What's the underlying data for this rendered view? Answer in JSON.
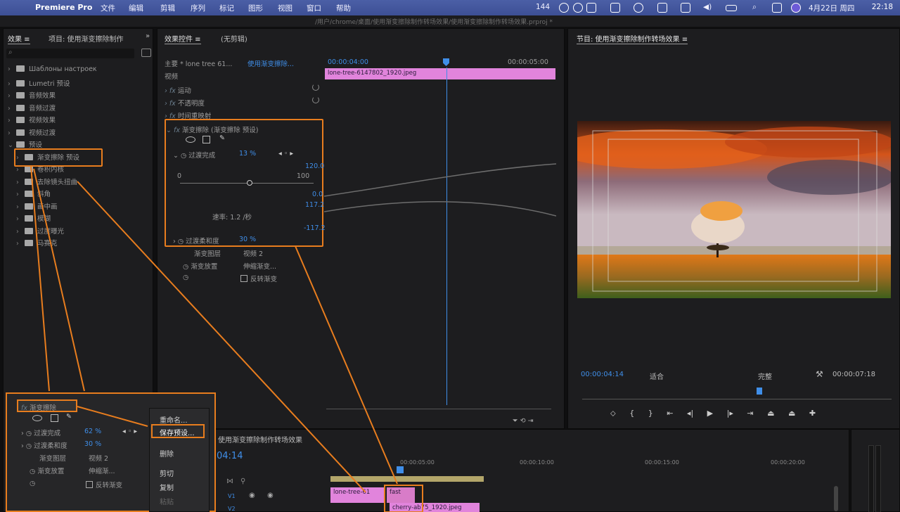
{
  "menubar": {
    "app": "Premiere Pro",
    "items": [
      "文件",
      "编辑",
      "剪辑",
      "序列",
      "标记",
      "图形",
      "视图",
      "窗口",
      "帮助"
    ],
    "battery": "144",
    "date": "4月22日 周四",
    "time": "22:18"
  },
  "titlebar": {
    "text": "/用户/chrome/桌面/使用渐变擦除制作转场效果/使用渐变擦除制作转场效果.prproj *"
  },
  "effects_panel": {
    "tabs": [
      "效果 ≡",
      "项目: 使用渐变擦除制作"
    ],
    "search_placeholder": "",
    "tree": [
      {
        "label": "Шаблоны настроек",
        "level": 0
      },
      {
        "label": "Lumetri 预设",
        "level": 0
      },
      {
        "label": "音频效果",
        "level": 0
      },
      {
        "label": "音频过渡",
        "level": 0
      },
      {
        "label": "视频效果",
        "level": 0
      },
      {
        "label": "视频过渡",
        "level": 0
      },
      {
        "label": "预设",
        "level": 0
      },
      {
        "label": "渐变擦除 预设",
        "level": 1
      },
      {
        "label": "卷积内核",
        "level": 1
      },
      {
        "label": "去除镜头扭曲",
        "level": 1
      },
      {
        "label": "斜角",
        "level": 1
      },
      {
        "label": "画中画",
        "level": 1
      },
      {
        "label": "模糊",
        "level": 1
      },
      {
        "label": "过度曝光",
        "level": 1
      },
      {
        "label": "马赛克",
        "level": 1
      }
    ]
  },
  "effect_controls": {
    "tabs": [
      "效果控件 ≡",
      "(无剪辑)"
    ],
    "source": "主要 * lone tree 61...",
    "sequence": "使用渐变擦除...",
    "section": "视频",
    "timecode_start": "00:00:04:00",
    "timecode_end": "00:00:05:00",
    "clip_name": "lone-tree-6147802_1920.jpeg",
    "rows": {
      "motion": "运动",
      "opacity": "不透明度",
      "time_remap": "时间重映射",
      "gradient_wipe": "渐变擦除 (渐变擦除 预设)",
      "transition_completion": "过渡完成",
      "transition_value": "13 %",
      "slider_min": "0",
      "slider_max": "100",
      "val_top": "120.0",
      "val_mid1": "0.0",
      "val_mid2": "117.2",
      "val_bottom": "-117.2",
      "speed": "速率: 1.2 /秒",
      "softness": "过渡柔和度",
      "softness_value": "30 %",
      "gradient_layer": "渐变图层",
      "gradient_layer_value": "视频 2",
      "gradient_placement": "渐变放置",
      "gradient_placement_value": "伸缩渐变...",
      "invert": "反转渐变"
    }
  },
  "program": {
    "tab": "节目: 使用渐变擦除制作转场效果 ≡",
    "timecode": "00:00:04:14",
    "fit": "适合",
    "quality": "完整",
    "duration": "00:00:07:18"
  },
  "timeline": {
    "title": "使用渐变擦除制作转场效果",
    "timecode": "04:14",
    "ruler": [
      "00:00:05:00",
      "00:00:10:00",
      "00:00:15:00",
      "00:00:20:00"
    ],
    "tracks": [
      "V1",
      "V2"
    ],
    "clips": [
      "lone-tree-61",
      "fast",
      "cherry-ab75_1920.jpeg"
    ]
  },
  "overlay": {
    "title": "渐变擦除",
    "transition": "过渡完成",
    "transition_value": "62 %",
    "softness": "过渡柔和度",
    "softness_value": "30 %",
    "layer": "渐变图层",
    "layer_value": "视频 2",
    "placement": "渐变放置",
    "placement_value": "伸缩渐...",
    "invert": "反转渐变"
  },
  "context_menu": {
    "items": [
      "重命名...",
      "保存预设...",
      "删除",
      "剪切",
      "复制",
      "粘贴"
    ]
  },
  "colors": {
    "accent": "#e87d1e",
    "clip": "#e184dc",
    "timecode": "#3f8ee8"
  }
}
